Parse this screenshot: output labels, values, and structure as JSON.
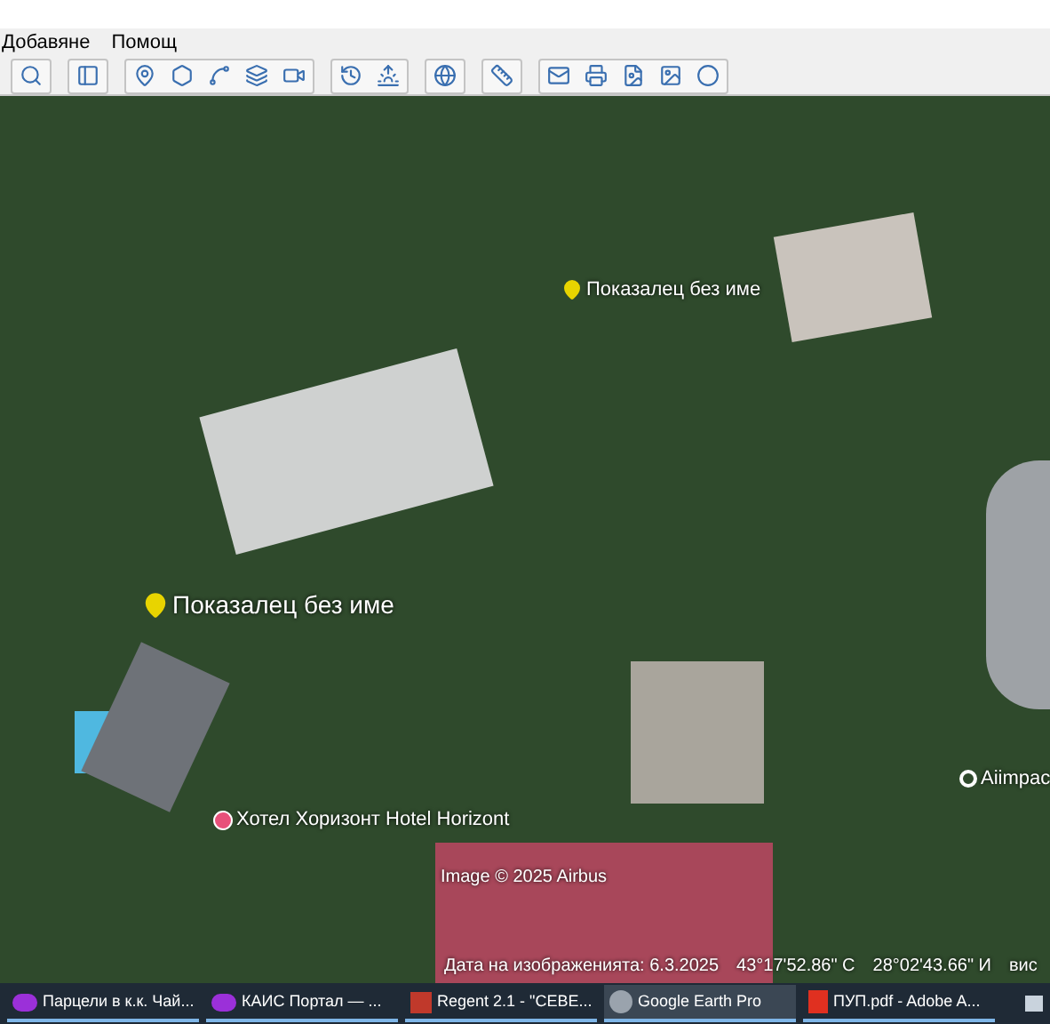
{
  "menu": [
    {
      "label": "Добавяне"
    },
    {
      "label": "Помощ"
    }
  ],
  "map": {
    "placemarks": [
      {
        "label": "Показалец без име",
        "kind": "pin"
      },
      {
        "label": "Показалец без име",
        "kind": "pin"
      },
      {
        "label": "Хотел Хоризонт Hotel Horizont",
        "kind": "poi"
      },
      {
        "label": "Aiimpac",
        "kind": "place"
      }
    ],
    "attribution": "Image © 2025 Airbus",
    "status": {
      "date": "Дата на изображенията: 6.3.2025",
      "lat": "43°17'52.86\" С",
      "lon": "28°02'43.66\" И",
      "elevation": "вис"
    }
  },
  "taskbar": [
    {
      "label": "Парцели в к.к. Чай...",
      "selected": false
    },
    {
      "label": "КАИС Портал — ...",
      "selected": false
    },
    {
      "label": "Regent 2.1 - \"СЕВЕ...",
      "selected": false
    },
    {
      "label": "Google Earth Pro",
      "selected": true
    },
    {
      "label": "ПУП.pdf - Adobe A...",
      "selected": false
    }
  ]
}
